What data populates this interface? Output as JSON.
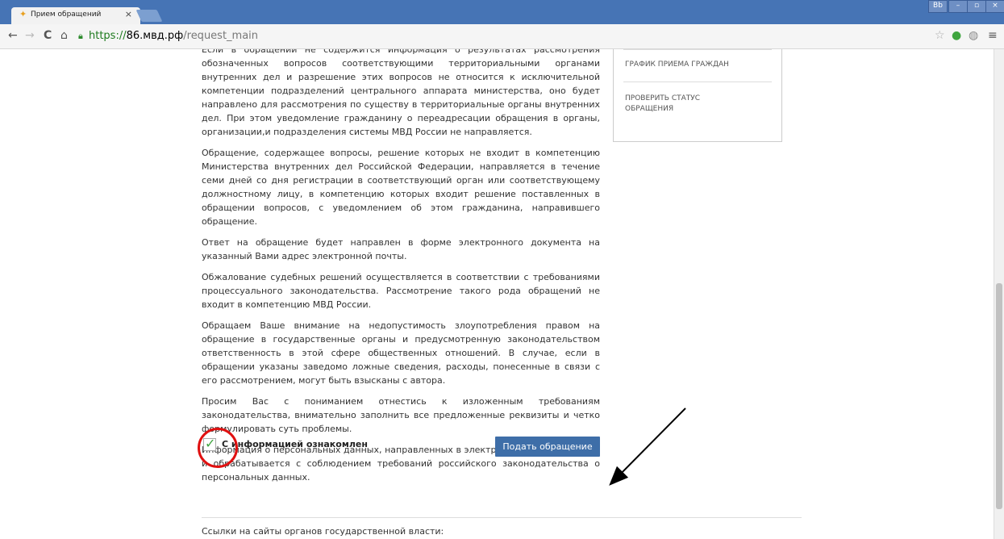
{
  "browser": {
    "tab_title": "Прием обращений",
    "tab_close": "×",
    "url_scheme": "https://",
    "url_host": "86.мвд.рф",
    "url_path": "/request_main",
    "window_user": "Bb",
    "minimize": "–",
    "maximize": "▫",
    "close": "×"
  },
  "sidebar": {
    "items": [
      "ГРАФИК ПРИЕМА ГРАЖДАН",
      "ПРОВЕРИТЬ СТАТУС ОБРАЩЕНИЯ"
    ]
  },
  "main": {
    "paragraphs": [
      "Если в обращении не содержится информация о результатах рассмотрения обозначенных вопросов соответствующими территориальными органами внутренних дел и разрешение этих вопросов не относится к исключительной компетенции подразделений центрального аппарата министерства, оно будет направлено для рассмотрения по существу в территориальные органы внутренних дел. При этом уведомление гражданину о переадресации обращения в органы, организации,и подразделения системы МВД России не направляется.",
      "Обращение, содержащее вопросы, решение которых не входит в компетенцию Министерства внутренних дел Российской Федерации, направляется в течение семи дней со дня регистрации в соответствующий орган или соответствующему должностному лицу, в компетенцию которых входит решение поставленных в обращении вопросов, с уведомлением об этом гражданина, направившего обращение.",
      "Ответ на обращение будет направлен в форме электронного документа на указанный Вами адрес электронной почты.",
      "Обжалование судебных решений осуществляется в соответствии с требованиями процессуального законодательства. Рассмотрение такого рода обращений не входит в компетенцию МВД России.",
      "Обращаем Ваше внимание на недопустимость злоупотребления правом на обращение в государственные органы и предусмотренную законодательством ответственность в этой сфере общественных отношений. В случае, если в обращении указаны заведомо ложные сведения, расходы, понесенные в связи с его рассмотрением, могут быть взысканы с автора.",
      "Просим Вас с пониманием отнестись к изложенным требованиям законодательства, внимательно заполнить все предложенные реквизиты и четко формулировать суть проблемы.",
      "Информация о персональных данных, направленных в электронном виде, хранится и обрабатывается с соблюдением требований российского законодательства о персональных данных."
    ],
    "checkbox_label": "С информацией ознакомлен",
    "checkbox_checked": true,
    "submit_label": "Подать обращение",
    "links_title": "Ссылки на сайты органов государственной власти:"
  },
  "colors": {
    "accent_button": "#3e6ea8",
    "annotation_red": "#e01010"
  }
}
